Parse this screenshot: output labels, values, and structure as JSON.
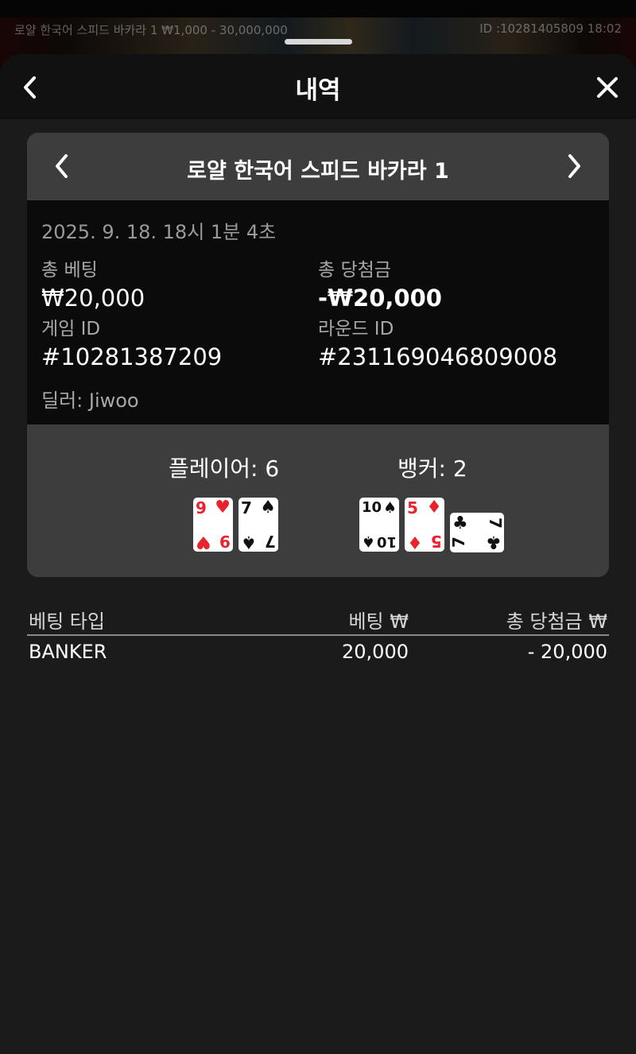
{
  "background": {
    "table_info": "로얄 한국어 스피드 바카라 1 ₩1,000 - 30,000,000",
    "round_info": "ID :10281405809 18:02"
  },
  "sheet": {
    "title": "내역"
  },
  "game": {
    "name": "로얄 한국어 스피드 바카라 1",
    "datetime": "2025. 9. 18. 18시 1분 4초",
    "total_bet_label": "총 베팅",
    "total_bet_value": "₩20,000",
    "total_win_label": "총 당첨금",
    "total_win_value": "-₩20,000",
    "game_id_label": "게임 ID",
    "game_id_value": "#10281387209",
    "round_id_label": "라운드 ID",
    "round_id_value": "#231169046809008",
    "dealer": "딜러: Jiwoo"
  },
  "result": {
    "player_score": "플레이어: 6",
    "banker_score": "뱅커: 2",
    "player_cards": [
      {
        "rank": "9",
        "suit": "♥",
        "color": "red"
      },
      {
        "rank": "7",
        "suit": "♠",
        "color": "black"
      }
    ],
    "banker_cards": [
      {
        "rank": "10",
        "suit": "♠",
        "color": "black"
      },
      {
        "rank": "5",
        "suit": "♦",
        "color": "red"
      },
      {
        "rank": "7",
        "suit": "♣",
        "color": "black",
        "orientation": "sideways"
      }
    ]
  },
  "bets": {
    "headers": {
      "type": "베팅 타입",
      "bet": "베팅 ₩",
      "win": "총 당첨금 ₩"
    },
    "rows": [
      {
        "type": "BANKER",
        "bet": "20,000",
        "win": "- 20,000"
      }
    ]
  },
  "icons": {
    "back": "chevron-left-icon",
    "close": "close-icon",
    "prev": "chevron-left-icon",
    "next": "chevron-right-icon"
  },
  "colors": {
    "card_red": "#e8232e",
    "panel": "#3d3d3d",
    "info_bg": "#0b0b0b",
    "sheet_bg": "#1b1b1b"
  }
}
